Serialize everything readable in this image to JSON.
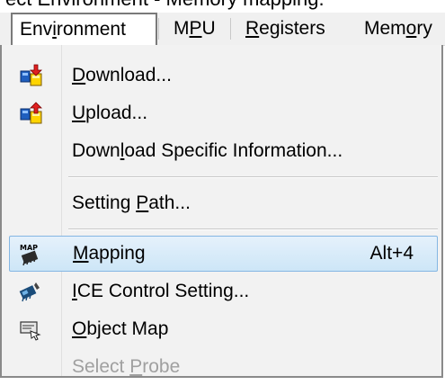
{
  "caption": "ect Environment - Memory mapping.",
  "menubar": {
    "items": [
      {
        "label": "Environment",
        "mnemonic": "i"
      },
      {
        "label": "MPU",
        "mnemonic": "P"
      },
      {
        "label": "Registers",
        "mnemonic": "R"
      },
      {
        "label": "Memory",
        "mnemonic": "o"
      }
    ]
  },
  "menu": {
    "items": [
      {
        "label": "Download...",
        "mnemonic": "D",
        "icon": "download-icon",
        "enabled": true
      },
      {
        "label": "Upload...",
        "mnemonic": "U",
        "icon": "upload-icon",
        "enabled": true
      },
      {
        "label": "Download Specific Information...",
        "mnemonic": "l",
        "enabled": true
      },
      {
        "label": "Setting Path...",
        "mnemonic": "P",
        "enabled": true
      },
      {
        "label": "Mapping",
        "mnemonic": "M",
        "accelerator": "Alt+4",
        "icon": "map-chip-icon",
        "enabled": true,
        "highlighted": true
      },
      {
        "label": "ICE Control Setting...",
        "mnemonic": "I",
        "icon": "ice-control-icon",
        "enabled": true
      },
      {
        "label": "Object Map",
        "mnemonic": "O",
        "icon": "object-map-icon",
        "enabled": true
      },
      {
        "label": "Select Probe",
        "mnemonic": "P",
        "enabled": false
      }
    ]
  },
  "colors": {
    "highlight_fill": "#cde6f7",
    "highlight_border": "#84b6e3",
    "disabled_text": "#a0a0a0",
    "menu_background": "#f2f2f2"
  }
}
